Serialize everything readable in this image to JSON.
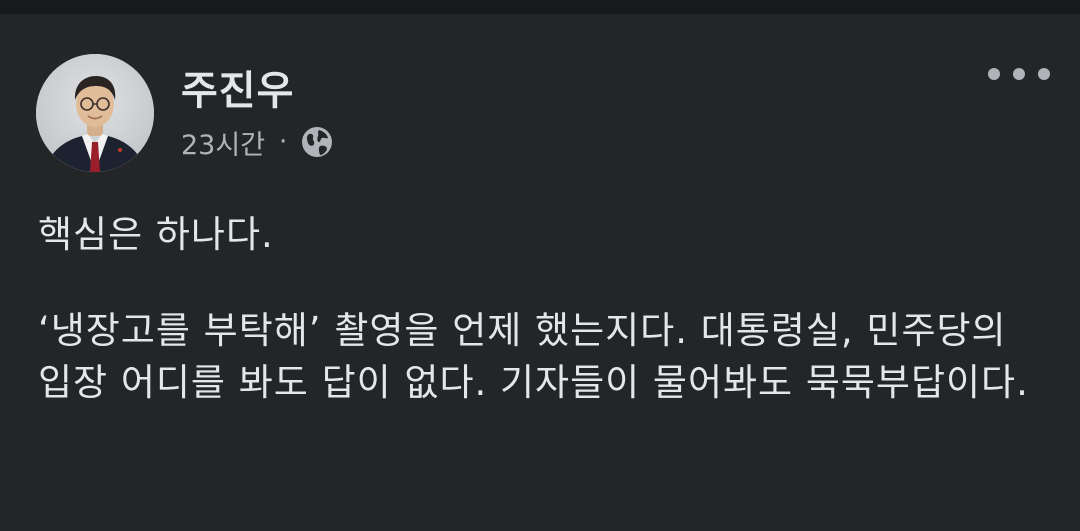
{
  "post": {
    "author": {
      "name": "주진우",
      "avatar_icon": "profile-photo"
    },
    "timestamp": "23시간",
    "separator": "·",
    "audience_icon": "globe-icon",
    "more_icon": "more-options-icon",
    "paragraphs": [
      "핵심은 하나다.",
      "‘냉장고를 부탁해’ 촬영을 언제 했는지다. 대통령실, 민주당의 입장 어디를 봐도 답이 없다. 기자들이 물어봐도 묵묵부답이다."
    ]
  },
  "colors": {
    "background": "#242527",
    "top_strip": "#18191a",
    "primary_text": "#e4e6eb",
    "secondary_text": "#b0b3b8"
  }
}
